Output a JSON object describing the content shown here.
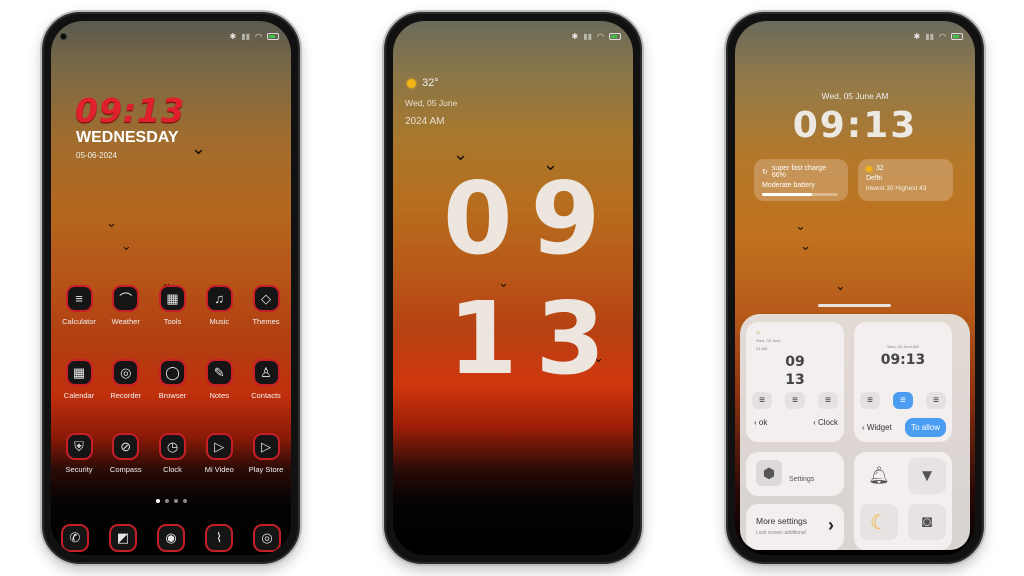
{
  "status_bar": {
    "bluetooth": "bluetooth-icon",
    "signal": "signal-icon",
    "wifi": "wifi-icon",
    "battery": "battery-icon"
  },
  "phone1": {
    "clock": "09:13",
    "day": "WEDNESDAY",
    "date": "05-06-2024",
    "apps_row1": [
      {
        "label": "Calculator",
        "icon": "≡"
      },
      {
        "label": "Weather",
        "icon": "⌒"
      },
      {
        "label": "Tools",
        "icon": "▦"
      },
      {
        "label": "Music",
        "icon": "♫"
      },
      {
        "label": "Themes",
        "icon": "◇"
      }
    ],
    "apps_row2": [
      {
        "label": "Calendar",
        "icon": "▦"
      },
      {
        "label": "Recorder",
        "icon": "◎"
      },
      {
        "label": "Browser",
        "icon": "◯"
      },
      {
        "label": "Notes",
        "icon": "✎"
      },
      {
        "label": "Contacts",
        "icon": "♙"
      }
    ],
    "apps_row3": [
      {
        "label": "Security",
        "icon": "⛨"
      },
      {
        "label": "Compass",
        "icon": "⊘"
      },
      {
        "label": "Clock",
        "icon": "◷"
      },
      {
        "label": "Mi Video",
        "icon": "▷"
      },
      {
        "label": "Play Store",
        "icon": "▷"
      }
    ],
    "dock": [
      {
        "name": "phone",
        "icon": "✆"
      },
      {
        "name": "messages",
        "icon": "◩"
      },
      {
        "name": "camera",
        "icon": "◉"
      },
      {
        "name": "gallery",
        "icon": "⌇"
      },
      {
        "name": "settings",
        "icon": "◎"
      }
    ],
    "page_count": 4,
    "active_page": 1
  },
  "phone2": {
    "temperature": "32°",
    "date": "Wed, 05 June",
    "year_ampm": "2024 AM",
    "hour": "09",
    "minute": "13"
  },
  "phone3": {
    "date": "Wed, 05 June AM",
    "clock": "09:13",
    "charge_widget": {
      "title": "super fast charge 66%",
      "subtitle": "Moderate battery",
      "progress_percent": 66
    },
    "weather_widget": {
      "temp": "32",
      "city": "Delhi",
      "range": "lowest 30 Highest 43"
    },
    "style_card_1": {
      "mini_temp": "32",
      "mini_date": "Wed, 05 June",
      "mini_year": "24 AM",
      "hour": "09",
      "minute": "13",
      "back_label": "ok",
      "next_label": "Clock"
    },
    "style_card_2": {
      "mini_date": "Wed, 05 June AM",
      "clock": "09:13",
      "back_label": "Widget",
      "allow_label": "To allow"
    },
    "settings_label": "Settings",
    "more_settings": {
      "title": "More settings",
      "subtitle": "Lock screen additional"
    },
    "quick_tiles": [
      "bell-icon",
      "flashlight-icon",
      "moon-icon",
      "camera-icon"
    ],
    "accent_color": "#4a9df0"
  }
}
